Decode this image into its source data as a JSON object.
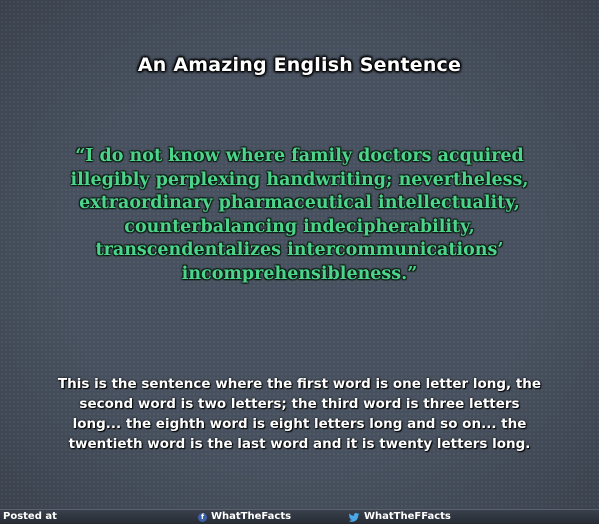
{
  "title": "An Amazing English Sentence",
  "quote": {
    "lines": [
      "“I do not know where family doctors acquired",
      "illegibly perplexing handwriting; nevertheless,",
      "extraordinary pharmaceutical intellectuality,",
      "counterbalancing indecipherability,",
      "transcendentalizes intercommunications’",
      "incomprehensibleness.”"
    ]
  },
  "explanation": {
    "lines": [
      "This is the sentence where the first word is one letter long, the",
      "second word is two letters; the third word is three letters",
      "long... the eighth word is eight letters long and so on... the",
      "twentieth word is the last word and it is twenty letters long."
    ]
  },
  "footer": {
    "posted_label": "Posted at",
    "facebook": {
      "icon": "facebook-icon",
      "label": "WhatTheFacts"
    },
    "twitter": {
      "icon": "twitter-icon",
      "label": "WhatTheFFacts"
    }
  },
  "colors": {
    "background": "#47505e",
    "quote_text": "#4cd58a",
    "title_text": "#ffffff"
  }
}
